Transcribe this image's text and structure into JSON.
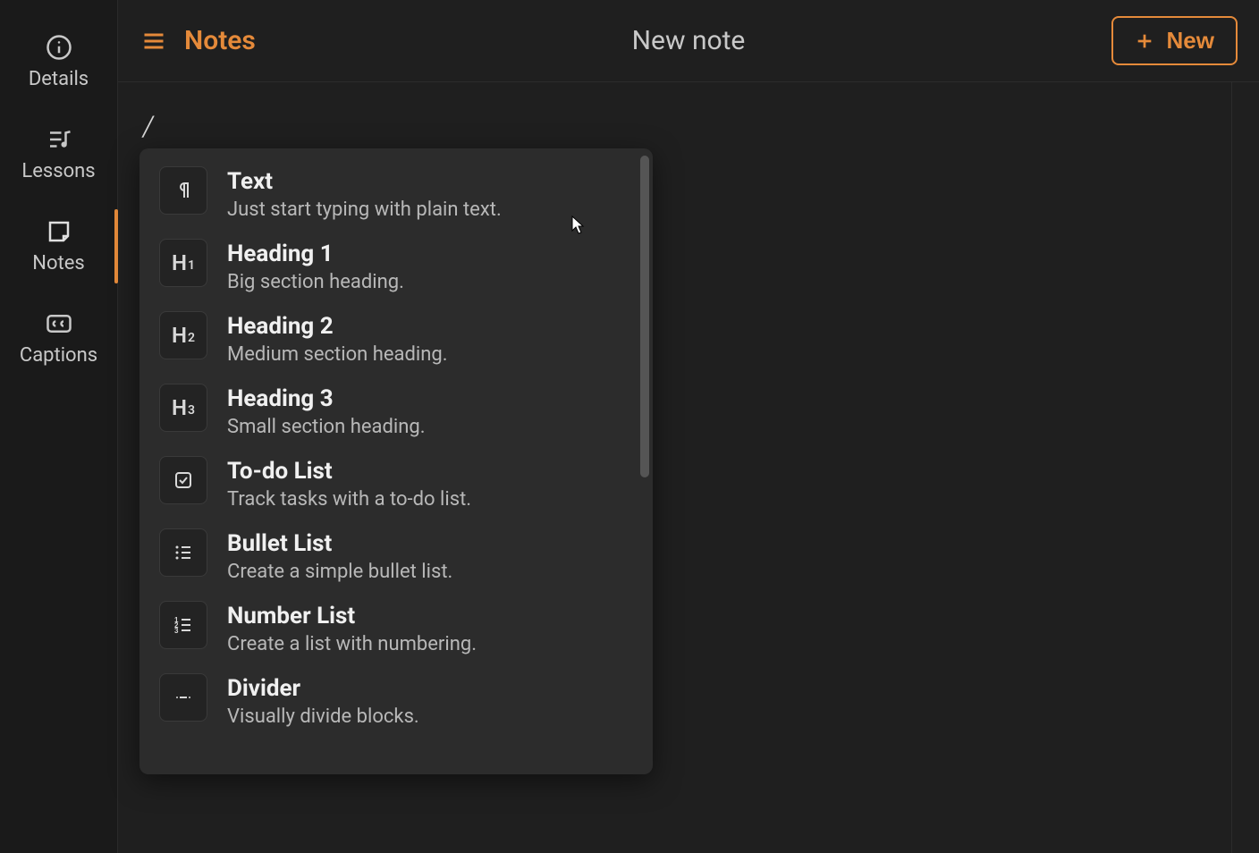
{
  "colors": {
    "bg": "#1a1a1a",
    "panel": "#1f1f1f",
    "menu": "#2c2c2c",
    "accent": "#e58a3a",
    "text": "#f0f0f0",
    "muted": "#c8c8c8"
  },
  "sidebar": {
    "items": [
      {
        "name": "details",
        "label": "Details",
        "icon": "info-icon",
        "active": false
      },
      {
        "name": "lessons",
        "label": "Lessons",
        "icon": "music-list-icon",
        "active": false
      },
      {
        "name": "notes",
        "label": "Notes",
        "icon": "sticky-note-icon",
        "active": true
      },
      {
        "name": "captions",
        "label": "Captions",
        "icon": "cc-icon",
        "active": false
      }
    ]
  },
  "topbar": {
    "section_label": "Notes",
    "page_title": "New note",
    "new_button_label": "New"
  },
  "editor": {
    "current_input": "/"
  },
  "command_menu": {
    "items": [
      {
        "icon": "pilcrow-icon",
        "title": "Text",
        "desc": "Just start typing with plain text."
      },
      {
        "icon": "h1-icon",
        "title": "Heading 1",
        "desc": "Big section heading."
      },
      {
        "icon": "h2-icon",
        "title": "Heading 2",
        "desc": "Medium section heading."
      },
      {
        "icon": "h3-icon",
        "title": "Heading 3",
        "desc": "Small section heading."
      },
      {
        "icon": "checkbox-icon",
        "title": "To-do List",
        "desc": "Track tasks with a to-do list."
      },
      {
        "icon": "bullet-list-icon",
        "title": "Bullet List",
        "desc": "Create a simple bullet list."
      },
      {
        "icon": "number-list-icon",
        "title": "Number List",
        "desc": "Create a list with numbering."
      },
      {
        "icon": "divider-icon",
        "title": "Divider",
        "desc": "Visually divide blocks."
      }
    ]
  }
}
